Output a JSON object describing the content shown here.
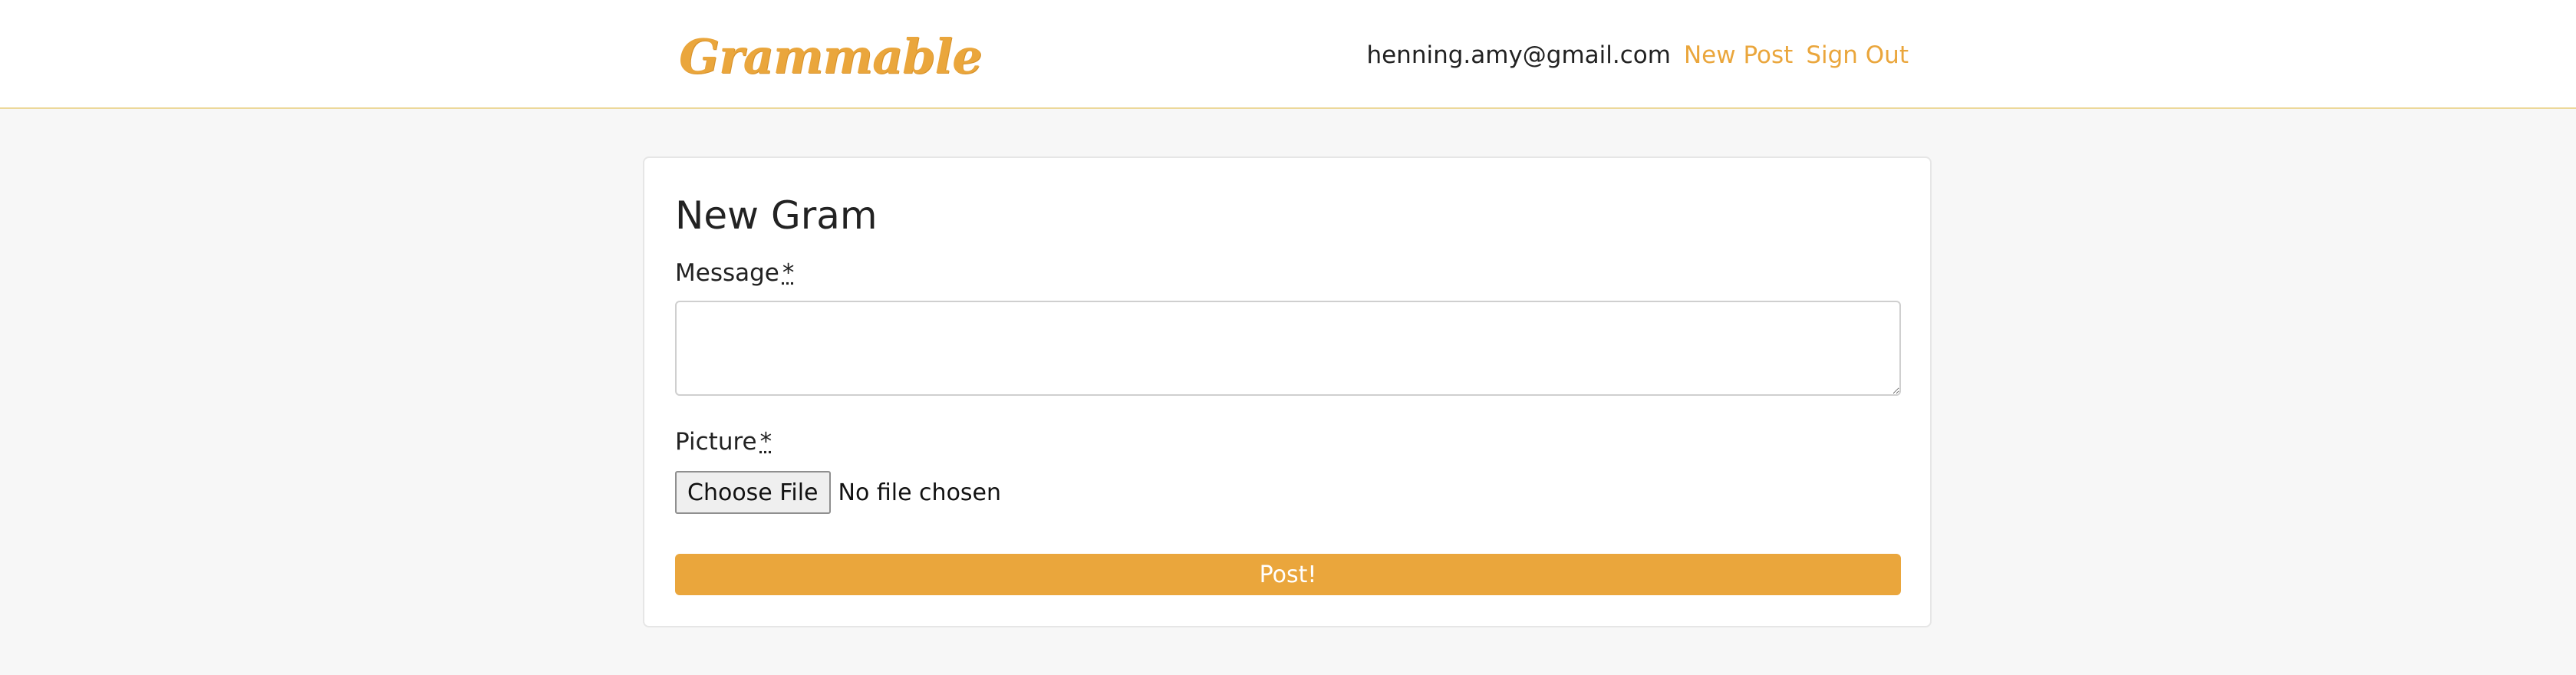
{
  "navbar": {
    "brand": "Grammable",
    "user_email": "henning.amy@gmail.com",
    "new_post_label": "New Post",
    "sign_out_label": "Sign Out"
  },
  "form": {
    "title": "New Gram",
    "message_label": "Message",
    "message_required_marker": "*",
    "message_value": "",
    "picture_label": "Picture",
    "picture_required_marker": "*",
    "choose_file_label": "Choose File",
    "file_status": "No file chosen",
    "submit_label": "Post!"
  },
  "colors": {
    "accent": "#eaa63c",
    "navbar_border": "#ecd89a",
    "page_background": "#f7f7f7"
  }
}
